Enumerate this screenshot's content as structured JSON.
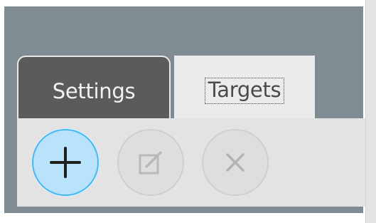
{
  "tabs": [
    {
      "label": "Settings",
      "active": false
    },
    {
      "label": "Targets",
      "active": true,
      "focused": true
    }
  ],
  "toolbar": {
    "buttons": [
      {
        "icon": "plus-icon",
        "state": "enabled"
      },
      {
        "icon": "edit-icon",
        "state": "disabled"
      },
      {
        "icon": "close-icon",
        "state": "disabled"
      }
    ]
  },
  "colors": {
    "background": "#7f8c91",
    "tab_inactive": "#5b5b5b",
    "tab_active": "#ebebeb",
    "panel": "#e3e3e3",
    "accent": "#45b8ef",
    "accent_fill": "#b9e3fb"
  }
}
